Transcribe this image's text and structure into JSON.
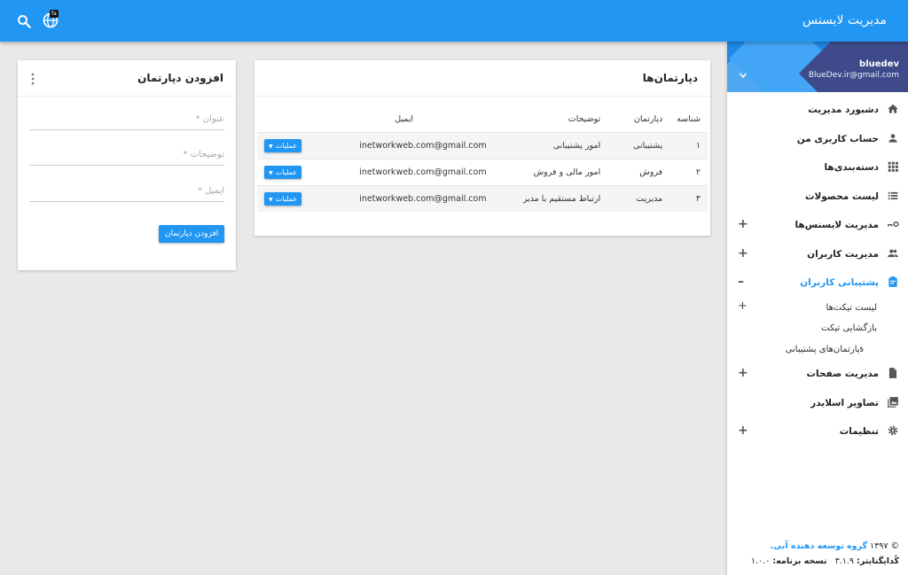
{
  "topbar": {
    "title": "مدیریت لایسنس",
    "globe_badge": "fa",
    "search_icon": "search-icon",
    "globe_icon": "globe-icon"
  },
  "colors": {
    "primary": "#2196f3",
    "background": "#e9e9e9",
    "profile_dark": "#3f4a8a"
  },
  "sidebar": {
    "profile": {
      "name": "bluedev",
      "email": "BlueDev.ir@gmail.com"
    },
    "menu": [
      {
        "label": "دشبورد مدیریت",
        "icon": "home-icon",
        "expand": ""
      },
      {
        "label": "حساب کاربری من",
        "icon": "person-icon",
        "expand": ""
      },
      {
        "label": "دسته‌بندی‌ها",
        "icon": "grid-icon",
        "expand": ""
      },
      {
        "label": "لیست محصولات",
        "icon": "list-icon",
        "expand": ""
      },
      {
        "label": "مدیریت لایسنس‌ها",
        "icon": "key-icon",
        "expand": "+"
      },
      {
        "label": "مدیریت کاربران",
        "icon": "people-icon",
        "expand": "+"
      },
      {
        "label": "پشتیبانی کاربران",
        "icon": "clipboard-icon",
        "expand": "–"
      }
    ],
    "submenu": [
      {
        "label": "لیست تیکت‌ها",
        "expand": "+"
      },
      {
        "label": "بازگشایی تیکت",
        "expand": ""
      },
      {
        "label": "دپارتمان‌های پشتیبانی",
        "expand": ""
      }
    ],
    "menu2": [
      {
        "label": "مدیریت صفحات",
        "icon": "file-icon",
        "expand": "+"
      },
      {
        "label": "تصاویر اسلایدر",
        "icon": "image-icon",
        "expand": ""
      },
      {
        "label": "تنظیمات",
        "icon": "gear-icon",
        "expand": "+"
      }
    ],
    "footer": {
      "copyright_prefix": "© ۱۳۹۷",
      "company": "گروه توسعه دهنده آبی.",
      "codeigniter_label": "کُدایگنایتر:",
      "codeigniter_version": "۳.۱.۹",
      "app_version_label": "نسخه برنامه:",
      "app_version": "۱.۰.۰"
    }
  },
  "departments": {
    "title": "دپارتمان‌ها",
    "columns": [
      "شناسه",
      "دپارتمان",
      "توضیحات",
      "ایمیل",
      ""
    ],
    "rows": [
      {
        "id": "۱",
        "name": "پشتیبانی",
        "description": "امور پشتیبانی",
        "email": "inetworkweb.com@gmail.com",
        "action": "عملیات"
      },
      {
        "id": "۲",
        "name": "فروش",
        "description": "امور مالی و فروش",
        "email": "inetworkweb.com@gmail.com",
        "action": "عملیات"
      },
      {
        "id": "۳",
        "name": "مدیریت",
        "description": "ارتباط مستقیم با مدیر",
        "email": "inetworkweb.com@gmail.com",
        "action": "عملیات"
      }
    ]
  },
  "add_department": {
    "title": "افزودن دپارتمان",
    "title_field_placeholder": "عنوان *",
    "description_field_placeholder": "توضیحات *",
    "email_field_placeholder": "ایمیل *",
    "submit_label": "افزودن دپارتمان"
  }
}
